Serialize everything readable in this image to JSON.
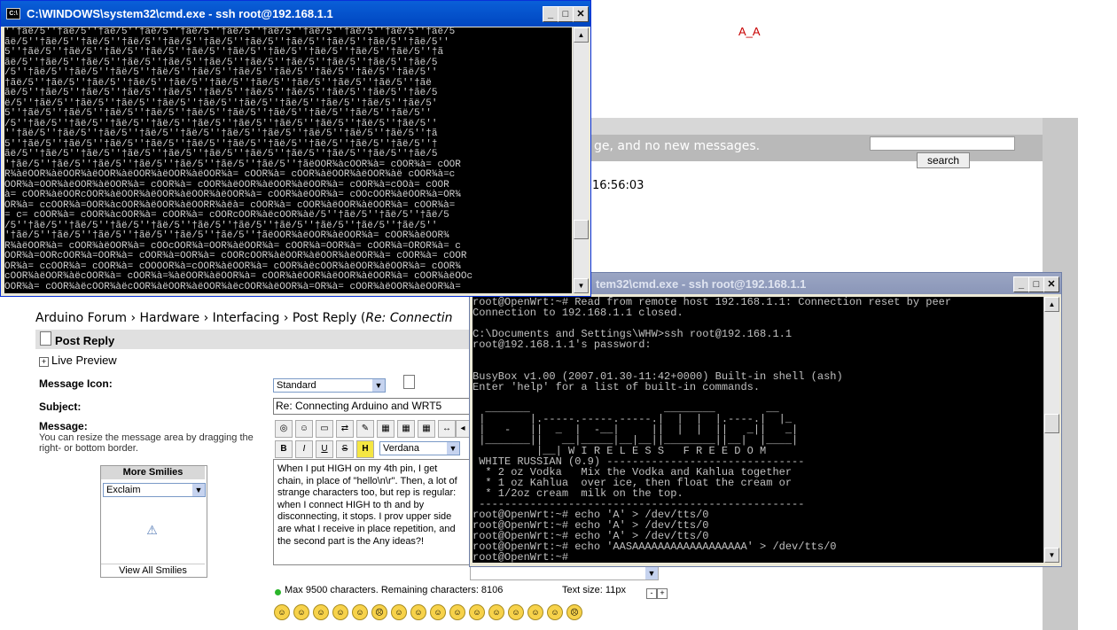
{
  "annotation": {
    "text": "A_A",
    "color": "#c80000"
  },
  "forum": {
    "header_message": "ge, and no new messages.",
    "search_label": "search",
    "time": "16:56:03",
    "breadcrumb": [
      "Arduino Forum",
      "Hardware",
      "Interfacing",
      "Post Reply"
    ],
    "breadcrumb_sep": "›",
    "breadcrumb_tail_prefix": "(",
    "breadcrumb_tail": "Re: Connectin",
    "post_reply_title": "Post Reply",
    "live_preview": "Live Preview",
    "message_icon_label": "Message Icon:",
    "message_icon_value": "Standard",
    "subject_label": "Subject:",
    "subject_value": "Re: Connecting Arduino and WRT5",
    "message_label": "Message:",
    "message_hint": "You can resize the message area by dragging the right- or bottom border.",
    "font_value": "Verdana",
    "message_body": "When I put HIGH on my 4th pin, I get chain, in place of \"hello\\n\\r\". Then, a lot of strange characters too, but rep is regular: when I connect HIGH to th and by disconnecting, it stops. I prov upper side are what I receive in place repetition, and the second part is the Any ideas?!",
    "smilies_title": "More Smilies",
    "smilies_select": "Exclaim",
    "view_all_smilies": "View All Smilies",
    "chars_info": "Max 9500 characters. Remaining characters: 8106",
    "text_size": "Text size: 11px",
    "text_size_minus": "-",
    "text_size_plus": "+",
    "toolbar_labels": {
      "bold": "B",
      "italic": "I",
      "underline": "U",
      "strike": "S",
      "highlight": "H"
    },
    "smiley_faces": [
      "☺",
      "☺",
      "☺",
      "☺",
      "☺",
      "☹",
      "☺",
      "☺",
      "☺",
      "☺",
      "☺",
      "☺",
      "☺",
      "☺",
      "☺",
      "☹"
    ]
  },
  "window1": {
    "title": "C:\\WINDOWS\\system32\\cmd.exe - ssh root@192.168.1.1",
    "lines": [
      "''†ãë/5''†ãë/5''†ãë/5''†ãë/5''†ãë/5''†ãë/5''†ãë/5''†ãë/5''†ãë/5''†ãë/5''†ãë/5",
      "ãë/5''†ãë/5''†ãë/5''†ãë/5''†ãë/5''†ãë/5''†ãë/5''†ãë/5''†ãë/5''†ãë/5''†ãë/5''",
      "5''†ãë/5''†ãë/5''†ãë/5''†ãë/5''†ãë/5''†ãë/5''†ãë/5''†ãë/5''†ãë/5''†ãë/5''†ã",
      "ãë/5''†ãë/5''†ãë/5''†ãë/5''†ãë/5''†ãë/5''†ãë/5''†ãë/5''†ãë/5''†ãë/5''†ãë/5",
      "/5''†ãë/5''†ãë/5''†ãë/5''†ãë/5''†ãë/5''†ãë/5''†ãë/5''†ãë/5''†ãë/5''†ãë/5''",
      "†ãë/5''†ãë/5''†ãë/5''†ãë/5''†ãë/5''†ãë/5''†ãë/5''†ãë/5''†ãë/5''†ãë/5''†ãë",
      "ãë/5''†ãë/5''†ãë/5''†ãë/5''†ãë/5''†ãë/5''†ãë/5''†ãë/5''†ãë/5''†ãë/5''†ãë/5",
      "ë/5''†ãë/5''†ãë/5''†ãë/5''†ãë/5''†ãë/5''†ãë/5''†ãë/5''†ãë/5''†ãë/5''†ãë/5'",
      "5''†ãë/5''†ãë/5''†ãë/5''†ãë/5''†ãë/5''†ãë/5''†ãë/5''†ãë/5''†ãë/5''†ãë/5''",
      "/5''†ãë/5''†ãë/5''†ãë/5''†ãë/5''†ãë/5''†ãë/5''†ãë/5''†ãë/5''†ãë/5''†ãë/5''",
      "''†ãë/5''†ãë/5''†ãë/5''†ãë/5''†ãë/5''†ãë/5''†ãë/5''†ãë/5''†ãë/5''†ãë/5''†ã",
      "5''†ãë/5''†ãë/5''†ãë/5''†ãë/5''†ãë/5''†ãë/5''†ãë/5''†ãë/5''†ãë/5''†ãë/5''†",
      "ãë/5''†ãë/5''†ãë/5''†ãë/5''†ãë/5''†ãë/5''†ãë/5''†ãë/5''†ãë/5''†ãë/5''†ãë/5",
      "'†ãë/5''†ãë/5''†ãë/5''†ãë/5''†ãë/5''†ãë/5''†ãë/5''†ãëOOR¾àcOOR¾à= cOOR¾à= cOOR",
      "R¾àëOOR¾àëOOR¾àëOOR¾àëOOR¾àëOOR¾àëOOR¾à= cOOR¾à= cOOR¾àëOOR¾àëOOR¾àë cOOR¾à=c",
      "OOR¾à=OOR¾àëOOR¾àëOOR¾à= cOOR¾à= cOOR¾àëOOR¾àëOOR¾àëOOR¾à= cOOR¾à=cOOà= cOOR",
      "à= cOOR¾àëOORcOOR¾àëOOR¾àëOOR¾àëOOR¾àëOOR¾à= cOOR¾àëOOR¾à= cOOcOOR¾àëOOR¾à=OR¾",
      "OR¾à= ccOOR¾à=OOR¾àcOOR¾àëOOR¾àëOORR¾àëà= cOOR¾à= cOOR¾àëOOR¾àëOOR¾à= cOOR¾à=",
      "= c= cOOR¾à= cOOR¾àcOOR¾à= cOOR¾à= cOORcOOR¾àëcOOR¾àë/5''†ãë/5''†ãë/5''†ãë/5",
      "/5''†ãë/5''†ãë/5''†ãë/5''†ãë/5''†ãë/5''†ãë/5''†ãë/5''†ãë/5''†ãë/5''†ãë/5''",
      "'†ãë/5''†ãë/5''†ãë/5''†ãë/5''†ãë/5''†ãë/5''†ãëOOR¾àëOOR¾àëOOR¾à= cOOR¾àëOOR¾",
      "R¾àëOOR¾à= cOOR¾àëOOR¾à= cOOcOOR¾à=OOR¾àëOOR¾à= cOOR¾à=OOR¾à= cOOR¾à=OROR¾à= c",
      "OOR¾à=OORcOOR¾à=OOR¾à= cOOR¾à=OOR¾à= cOORcOOR¾àëOOR¾àëOOR¾àëOOR¾à= cOOR¾à= cOOR",
      "OR¾à= ccOOR¾à= cOOR¾à= cOOOOR¾à=cOOR¾àëOOR¾à= cOOR¾àëcOOR¾àëOOR¾àëOOR¾à= cOOR¾",
      "cOOR¾àëOOR¾àëcOOR¾à= cOOR¾à=¾àëOOR¾àëOOR¾à= cOOR¾àëOOR¾àëOOR¾àëOOR¾à= cOOR¾àëOOc",
      "OOR¾à= cOOR¾àëcOOR¾àëcOOR¾àëOOR¾àëOOR¾àëcOOR¾àëOOR¾à=OR¾à= cOOR¾àëOOR¾àëOOR¾à="
    ]
  },
  "window2": {
    "title": "tem32\\cmd.exe - ssh root@192.168.1.1",
    "lines": [
      "root@OpenWrt:~# Read from remote host 192.168.1.1: Connection reset by peer",
      "Connection to 192.168.1.1 closed.",
      "",
      "C:\\Documents and Settings\\WHW>ssh root@192.168.1.1",
      "root@192.168.1.1's password:",
      "",
      "",
      "BusyBox v1.00 (2007.01.30-11:42+0000) Built-in shell (ash)",
      "Enter 'help' for a list of built-in commands.",
      "",
      "  _______                     ________        __",
      " |       |.-----.-----.-----.|  |  |  |.----.|  |_",
      " |   -   ||  _  |  -__|     ||  |  |  ||   _||   _|",
      " |_______||   __|_____|__|__||________||__|  |____|",
      "          |__| W I R E L E S S   F R E E D O M",
      " WHITE RUSSIAN (0.9) -------------------------------",
      "  * 2 oz Vodka   Mix the Vodka and Kahlua together",
      "  * 1 oz Kahlua  over ice, then float the cream or",
      "  * 1/2oz cream  milk on the top.",
      " ---------------------------------------------------",
      "root@OpenWrt:~# echo 'A' > /dev/tts/0",
      "root@OpenWrt:~# echo 'A' > /dev/tts/0",
      "root@OpenWrt:~# echo 'A' > /dev/tts/0",
      "root@OpenWrt:~# echo 'AASAAAAAAAAAAAAAAAAAA' > /dev/tts/0",
      "root@OpenWrt:~#"
    ]
  },
  "window_buttons": {
    "minimize": "_",
    "maximize": "□",
    "close": "✕"
  },
  "scroll_arrows": {
    "up": "▲",
    "down": "▼"
  },
  "colors": {
    "titlebar_active": "#0054e3",
    "titlebar_inactive": "#8a96b8",
    "console_bg": "#000000",
    "console_fg": "#c0c0c0"
  }
}
